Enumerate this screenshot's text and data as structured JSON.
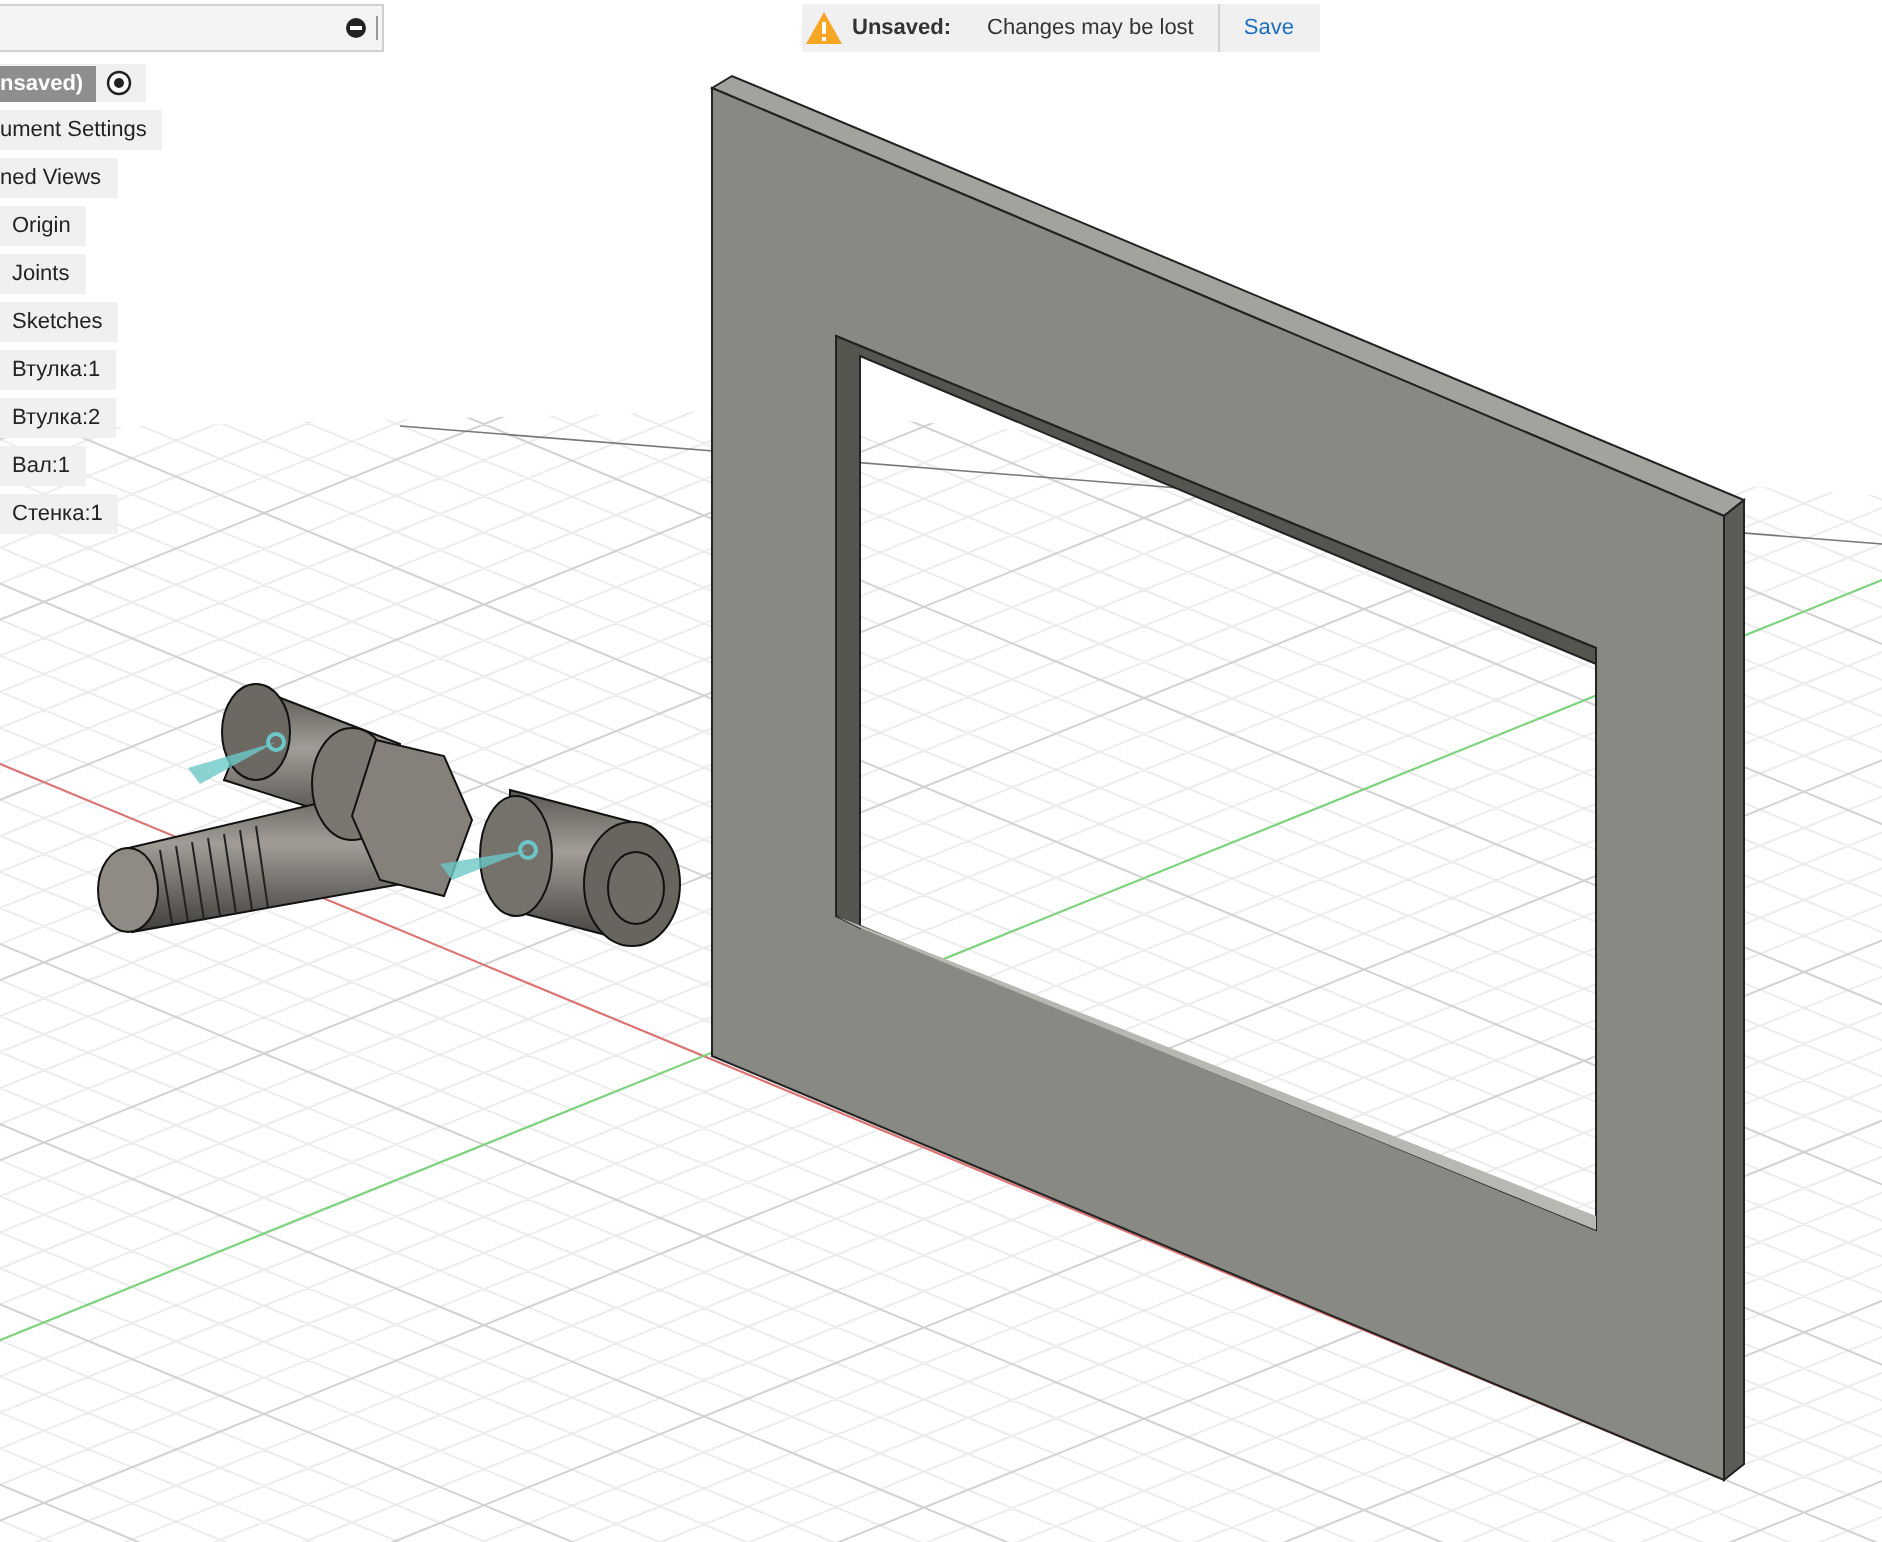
{
  "browser": {
    "root": {
      "label": "nsaved)",
      "active": true,
      "checked": true
    },
    "items": [
      {
        "label": "ument Settings",
        "kind": "clipped"
      },
      {
        "label": "ned Views",
        "kind": "clipped"
      },
      {
        "label": "Origin",
        "kind": "item"
      },
      {
        "label": "Joints",
        "kind": "item"
      },
      {
        "label": "Sketches",
        "kind": "item"
      },
      {
        "label": "Втулка:1",
        "kind": "item"
      },
      {
        "label": "Втулка:2",
        "kind": "item"
      },
      {
        "label": "Вал:1",
        "kind": "item"
      },
      {
        "label": "Стенка:1",
        "kind": "item"
      }
    ]
  },
  "save_bar": {
    "status": "Unsaved:",
    "message": "Changes may be lost",
    "action": "Save"
  }
}
